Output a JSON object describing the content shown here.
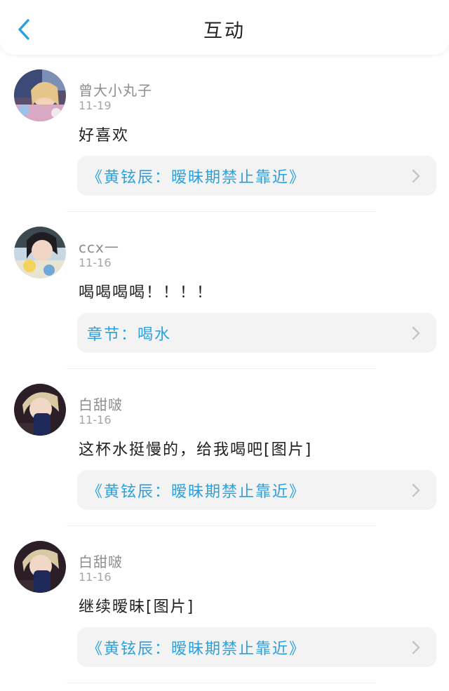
{
  "header": {
    "title": "互动",
    "back_icon": "chevron-left-icon",
    "accent": "#2aa0df"
  },
  "items": [
    {
      "username": "曾大小丸子",
      "date": "11-19",
      "comment": "好喜欢",
      "link": "《黄铉辰：暧昧期禁止靠近》",
      "avatar": "avatar-image"
    },
    {
      "username": "ccx一",
      "date": "11-16",
      "comment": "喝喝喝喝！！！！",
      "link": "章节：喝水",
      "avatar": "avatar-image"
    },
    {
      "username": "白甜啵",
      "date": "11-16",
      "comment": "这杯水挺慢的，给我喝吧[图片]",
      "link": "《黄铉辰：暧昧期禁止靠近》",
      "avatar": "avatar-image"
    },
    {
      "username": "白甜啵",
      "date": "11-16",
      "comment": "继续暧昧[图片]",
      "link": "《黄铉辰：暧昧期禁止靠近》",
      "avatar": "avatar-image"
    }
  ]
}
